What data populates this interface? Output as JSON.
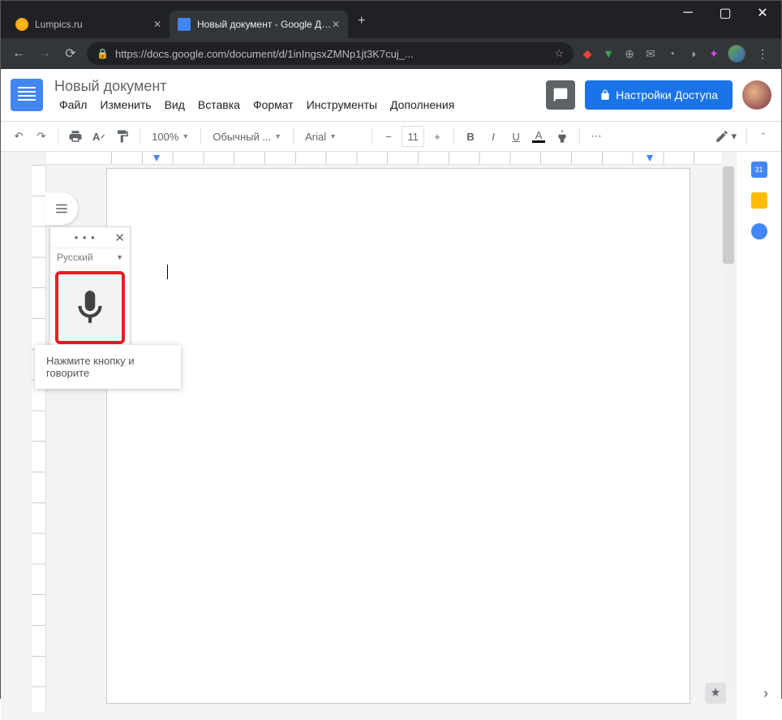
{
  "browser": {
    "tabs": [
      {
        "title": "Lumpics.ru",
        "active": false
      },
      {
        "title": "Новый документ - Google Доку",
        "active": true
      }
    ],
    "url": "https://docs.google.com/document/d/1inIngsxZMNp1jt3K7cuj_..."
  },
  "docs": {
    "title": "Новый документ",
    "menus": [
      "Файл",
      "Изменить",
      "Вид",
      "Вставка",
      "Формат",
      "Инструменты",
      "Дополнения"
    ],
    "share": "Настройки Доступа"
  },
  "toolbar": {
    "zoom": "100%",
    "style": "Обычный ...",
    "font": "Arial",
    "size": "11"
  },
  "voice": {
    "language": "Русский",
    "tooltip": "Нажмите кнопку и говорите"
  }
}
